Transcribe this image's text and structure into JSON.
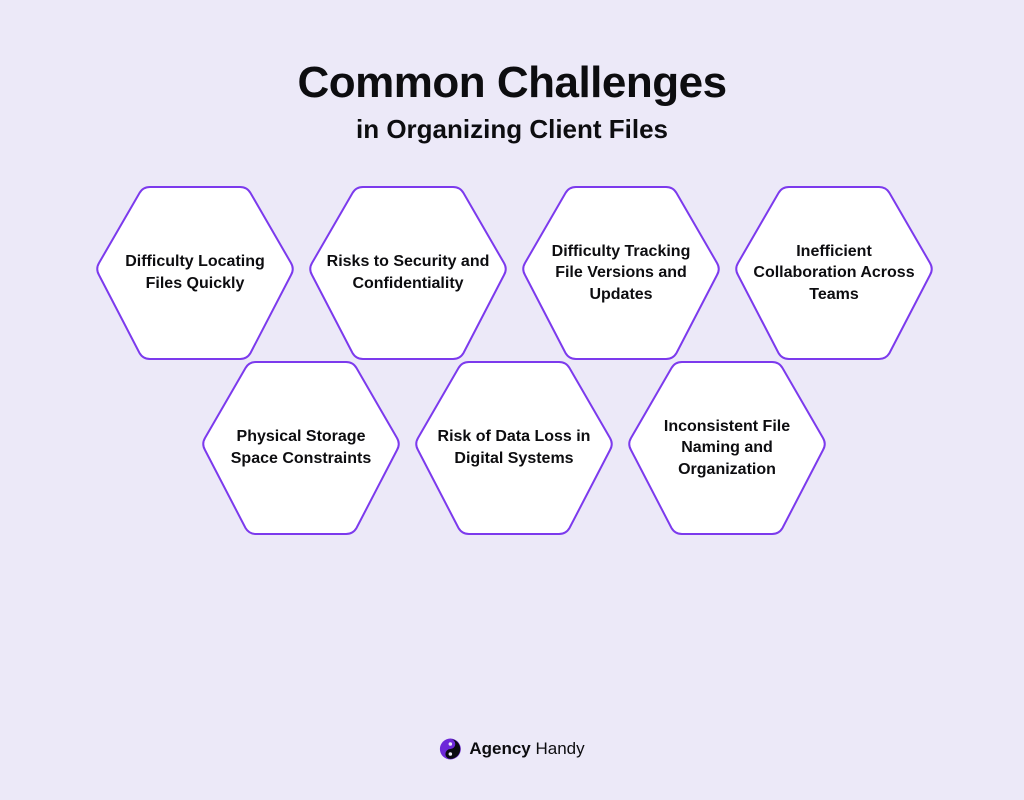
{
  "header": {
    "title": "Common Challenges",
    "subtitle": "in Organizing Client Files"
  },
  "colors": {
    "background": "#ece9f8",
    "hex_fill": "#ffffff",
    "hex_stroke": "#7c3aed",
    "text": "#0d0d10",
    "logo_primary": "#6d28d9",
    "logo_secondary": "#020617"
  },
  "hexagons": {
    "row1": [
      {
        "label": "Difficulty Locating Files Quickly"
      },
      {
        "label": "Risks to Security and Confidentiality"
      },
      {
        "label": "Difficulty Tracking File Versions and Updates"
      },
      {
        "label": "Inefficient Collaboration Across Teams"
      }
    ],
    "row2": [
      {
        "label": "Physical Storage Space Constraints"
      },
      {
        "label": "Risk of Data Loss in Digital Systems"
      },
      {
        "label": "Inconsistent File Naming and Organization"
      }
    ]
  },
  "brand": {
    "name_bold": "Agency",
    "name_regular": " Handy",
    "icon": "yin-yang-swirl-icon"
  }
}
